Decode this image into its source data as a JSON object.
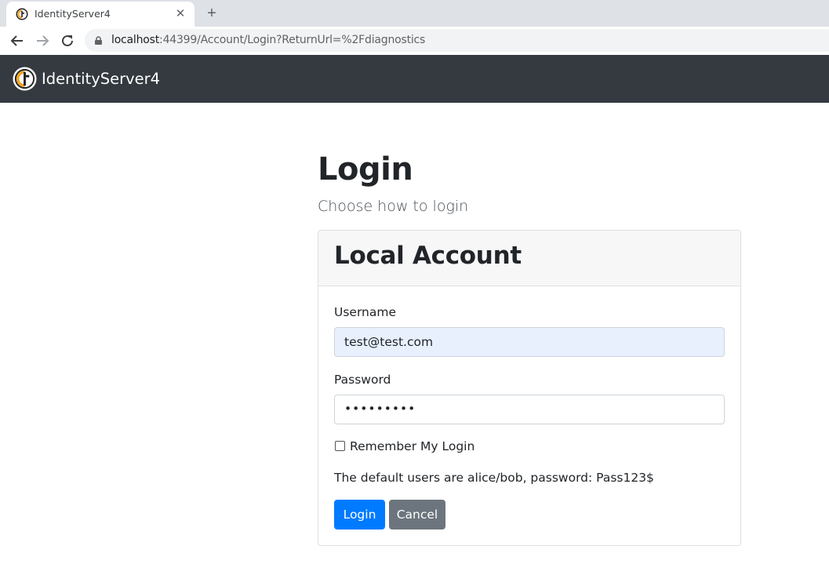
{
  "browser": {
    "tab_title": "IdentityServer4",
    "url_host": "localhost",
    "url_rest": ":44399/Account/Login?ReturnUrl=%2Fdiagnostics"
  },
  "navbar": {
    "brand": "IdentityServer4",
    "background": "#343a40"
  },
  "page": {
    "title": "Login",
    "subtitle": "Choose how to login"
  },
  "card": {
    "title": "Local Account",
    "username_label": "Username",
    "username_value": "test@test.com",
    "password_label": "Password",
    "password_value": "•••••••••",
    "remember_label": "Remember My Login",
    "remember_checked": false,
    "note": "The default users are alice/bob, password: Pass123$",
    "login_button": "Login",
    "cancel_button": "Cancel"
  },
  "colors": {
    "primary": "#007bff",
    "secondary": "#6c757d",
    "autofill": "#e8f0fe"
  }
}
